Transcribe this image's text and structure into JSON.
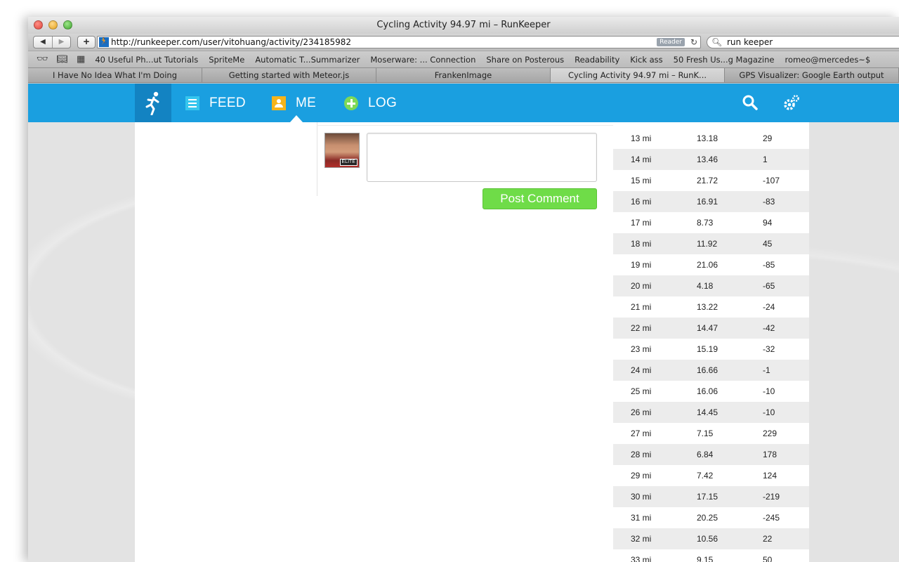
{
  "browser": {
    "title": "Cycling Activity 94.97 mi – RunKeeper",
    "url": "http://runkeeper.com/user/vitohuang/activity/234185982",
    "reader_label": "Reader",
    "search_value": "run keeper",
    "bookmarks": [
      "40 Useful Ph...ut Tutorials",
      "SpriteMe",
      "Automatic T...Summarizer",
      "Moserware: ... Connection",
      "Share on Posterous",
      "Readability",
      "Kick ass",
      "50 Fresh Us...g Magazine",
      "romeo@mercedes~$"
    ],
    "tabs": [
      {
        "label": "I Have No Idea What I'm Doing"
      },
      {
        "label": "Getting started with Meteor.js"
      },
      {
        "label": "FrankenImage"
      },
      {
        "label": "Cycling Activity 94.97 mi – RunK..."
      },
      {
        "label": "GPS Visualizer: Google Earth output"
      }
    ]
  },
  "nav": {
    "feed": "FEED",
    "me": "ME",
    "log": "LOG"
  },
  "comment": {
    "badge": "ELITE",
    "placeholder": "",
    "post_label": "Post Comment"
  },
  "splits": [
    {
      "dist": "13 mi",
      "pace": "13.18",
      "elev": "29"
    },
    {
      "dist": "14 mi",
      "pace": "13.46",
      "elev": "1"
    },
    {
      "dist": "15 mi",
      "pace": "21.72",
      "elev": "-107"
    },
    {
      "dist": "16 mi",
      "pace": "16.91",
      "elev": "-83"
    },
    {
      "dist": "17 mi",
      "pace": "8.73",
      "elev": "94"
    },
    {
      "dist": "18 mi",
      "pace": "11.92",
      "elev": "45"
    },
    {
      "dist": "19 mi",
      "pace": "21.06",
      "elev": "-85"
    },
    {
      "dist": "20 mi",
      "pace": "4.18",
      "elev": "-65"
    },
    {
      "dist": "21 mi",
      "pace": "13.22",
      "elev": "-24"
    },
    {
      "dist": "22 mi",
      "pace": "14.47",
      "elev": "-42"
    },
    {
      "dist": "23 mi",
      "pace": "15.19",
      "elev": "-32"
    },
    {
      "dist": "24 mi",
      "pace": "16.66",
      "elev": "-1"
    },
    {
      "dist": "25 mi",
      "pace": "16.06",
      "elev": "-10"
    },
    {
      "dist": "26 mi",
      "pace": "14.45",
      "elev": "-10"
    },
    {
      "dist": "27 mi",
      "pace": "7.15",
      "elev": "229"
    },
    {
      "dist": "28 mi",
      "pace": "6.84",
      "elev": "178"
    },
    {
      "dist": "29 mi",
      "pace": "7.42",
      "elev": "124"
    },
    {
      "dist": "30 mi",
      "pace": "17.15",
      "elev": "-219"
    },
    {
      "dist": "31 mi",
      "pace": "20.25",
      "elev": "-245"
    },
    {
      "dist": "32 mi",
      "pace": "10.56",
      "elev": "22"
    },
    {
      "dist": "33 mi",
      "pace": "9.15",
      "elev": "50"
    }
  ]
}
